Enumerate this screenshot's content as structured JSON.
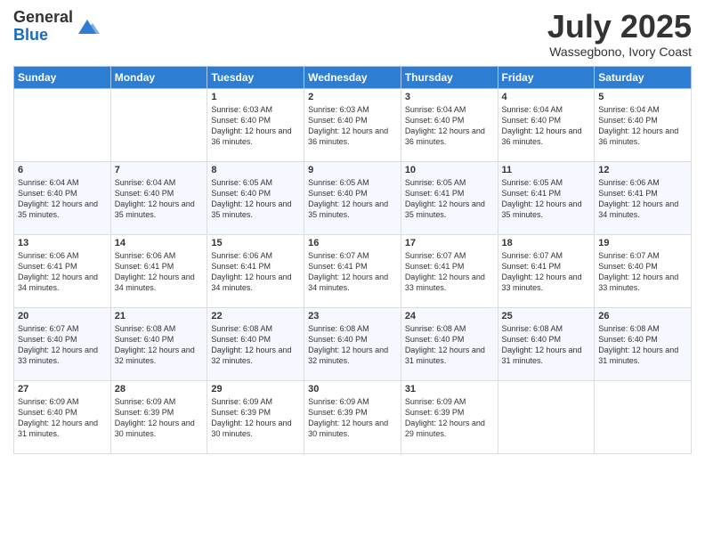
{
  "logo": {
    "line1": "General",
    "line2": "Blue"
  },
  "title": "July 2025",
  "location": "Wassegbono, Ivory Coast",
  "days_header": [
    "Sunday",
    "Monday",
    "Tuesday",
    "Wednesday",
    "Thursday",
    "Friday",
    "Saturday"
  ],
  "weeks": [
    [
      {
        "day": "",
        "sunrise": "",
        "sunset": "",
        "daylight": ""
      },
      {
        "day": "",
        "sunrise": "",
        "sunset": "",
        "daylight": ""
      },
      {
        "day": "1",
        "sunrise": "Sunrise: 6:03 AM",
        "sunset": "Sunset: 6:40 PM",
        "daylight": "Daylight: 12 hours and 36 minutes."
      },
      {
        "day": "2",
        "sunrise": "Sunrise: 6:03 AM",
        "sunset": "Sunset: 6:40 PM",
        "daylight": "Daylight: 12 hours and 36 minutes."
      },
      {
        "day": "3",
        "sunrise": "Sunrise: 6:04 AM",
        "sunset": "Sunset: 6:40 PM",
        "daylight": "Daylight: 12 hours and 36 minutes."
      },
      {
        "day": "4",
        "sunrise": "Sunrise: 6:04 AM",
        "sunset": "Sunset: 6:40 PM",
        "daylight": "Daylight: 12 hours and 36 minutes."
      },
      {
        "day": "5",
        "sunrise": "Sunrise: 6:04 AM",
        "sunset": "Sunset: 6:40 PM",
        "daylight": "Daylight: 12 hours and 36 minutes."
      }
    ],
    [
      {
        "day": "6",
        "sunrise": "Sunrise: 6:04 AM",
        "sunset": "Sunset: 6:40 PM",
        "daylight": "Daylight: 12 hours and 35 minutes."
      },
      {
        "day": "7",
        "sunrise": "Sunrise: 6:04 AM",
        "sunset": "Sunset: 6:40 PM",
        "daylight": "Daylight: 12 hours and 35 minutes."
      },
      {
        "day": "8",
        "sunrise": "Sunrise: 6:05 AM",
        "sunset": "Sunset: 6:40 PM",
        "daylight": "Daylight: 12 hours and 35 minutes."
      },
      {
        "day": "9",
        "sunrise": "Sunrise: 6:05 AM",
        "sunset": "Sunset: 6:40 PM",
        "daylight": "Daylight: 12 hours and 35 minutes."
      },
      {
        "day": "10",
        "sunrise": "Sunrise: 6:05 AM",
        "sunset": "Sunset: 6:41 PM",
        "daylight": "Daylight: 12 hours and 35 minutes."
      },
      {
        "day": "11",
        "sunrise": "Sunrise: 6:05 AM",
        "sunset": "Sunset: 6:41 PM",
        "daylight": "Daylight: 12 hours and 35 minutes."
      },
      {
        "day": "12",
        "sunrise": "Sunrise: 6:06 AM",
        "sunset": "Sunset: 6:41 PM",
        "daylight": "Daylight: 12 hours and 34 minutes."
      }
    ],
    [
      {
        "day": "13",
        "sunrise": "Sunrise: 6:06 AM",
        "sunset": "Sunset: 6:41 PM",
        "daylight": "Daylight: 12 hours and 34 minutes."
      },
      {
        "day": "14",
        "sunrise": "Sunrise: 6:06 AM",
        "sunset": "Sunset: 6:41 PM",
        "daylight": "Daylight: 12 hours and 34 minutes."
      },
      {
        "day": "15",
        "sunrise": "Sunrise: 6:06 AM",
        "sunset": "Sunset: 6:41 PM",
        "daylight": "Daylight: 12 hours and 34 minutes."
      },
      {
        "day": "16",
        "sunrise": "Sunrise: 6:07 AM",
        "sunset": "Sunset: 6:41 PM",
        "daylight": "Daylight: 12 hours and 34 minutes."
      },
      {
        "day": "17",
        "sunrise": "Sunrise: 6:07 AM",
        "sunset": "Sunset: 6:41 PM",
        "daylight": "Daylight: 12 hours and 33 minutes."
      },
      {
        "day": "18",
        "sunrise": "Sunrise: 6:07 AM",
        "sunset": "Sunset: 6:41 PM",
        "daylight": "Daylight: 12 hours and 33 minutes."
      },
      {
        "day": "19",
        "sunrise": "Sunrise: 6:07 AM",
        "sunset": "Sunset: 6:40 PM",
        "daylight": "Daylight: 12 hours and 33 minutes."
      }
    ],
    [
      {
        "day": "20",
        "sunrise": "Sunrise: 6:07 AM",
        "sunset": "Sunset: 6:40 PM",
        "daylight": "Daylight: 12 hours and 33 minutes."
      },
      {
        "day": "21",
        "sunrise": "Sunrise: 6:08 AM",
        "sunset": "Sunset: 6:40 PM",
        "daylight": "Daylight: 12 hours and 32 minutes."
      },
      {
        "day": "22",
        "sunrise": "Sunrise: 6:08 AM",
        "sunset": "Sunset: 6:40 PM",
        "daylight": "Daylight: 12 hours and 32 minutes."
      },
      {
        "day": "23",
        "sunrise": "Sunrise: 6:08 AM",
        "sunset": "Sunset: 6:40 PM",
        "daylight": "Daylight: 12 hours and 32 minutes."
      },
      {
        "day": "24",
        "sunrise": "Sunrise: 6:08 AM",
        "sunset": "Sunset: 6:40 PM",
        "daylight": "Daylight: 12 hours and 31 minutes."
      },
      {
        "day": "25",
        "sunrise": "Sunrise: 6:08 AM",
        "sunset": "Sunset: 6:40 PM",
        "daylight": "Daylight: 12 hours and 31 minutes."
      },
      {
        "day": "26",
        "sunrise": "Sunrise: 6:08 AM",
        "sunset": "Sunset: 6:40 PM",
        "daylight": "Daylight: 12 hours and 31 minutes."
      }
    ],
    [
      {
        "day": "27",
        "sunrise": "Sunrise: 6:09 AM",
        "sunset": "Sunset: 6:40 PM",
        "daylight": "Daylight: 12 hours and 31 minutes."
      },
      {
        "day": "28",
        "sunrise": "Sunrise: 6:09 AM",
        "sunset": "Sunset: 6:39 PM",
        "daylight": "Daylight: 12 hours and 30 minutes."
      },
      {
        "day": "29",
        "sunrise": "Sunrise: 6:09 AM",
        "sunset": "Sunset: 6:39 PM",
        "daylight": "Daylight: 12 hours and 30 minutes."
      },
      {
        "day": "30",
        "sunrise": "Sunrise: 6:09 AM",
        "sunset": "Sunset: 6:39 PM",
        "daylight": "Daylight: 12 hours and 30 minutes."
      },
      {
        "day": "31",
        "sunrise": "Sunrise: 6:09 AM",
        "sunset": "Sunset: 6:39 PM",
        "daylight": "Daylight: 12 hours and 29 minutes."
      },
      {
        "day": "",
        "sunrise": "",
        "sunset": "",
        "daylight": ""
      },
      {
        "day": "",
        "sunrise": "",
        "sunset": "",
        "daylight": ""
      }
    ]
  ]
}
